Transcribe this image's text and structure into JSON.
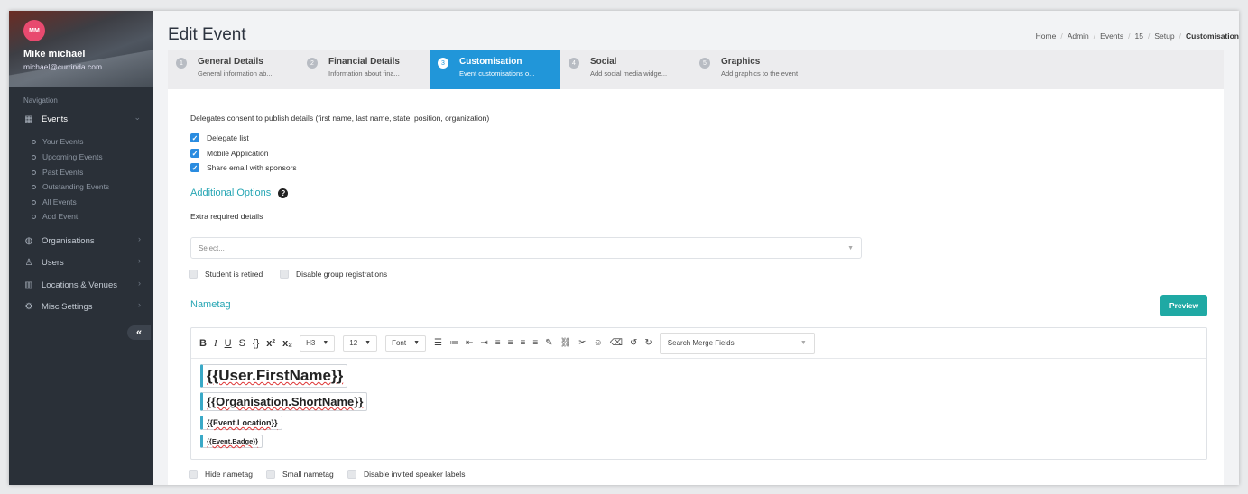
{
  "sidebar": {
    "avatar_initials": "MM",
    "user_name": "Mike michael",
    "user_email": "michael@currinda.com",
    "nav_heading": "Navigation",
    "items": [
      {
        "label": "Events",
        "icon": "calendar-icon"
      },
      {
        "label": "Organisations",
        "icon": "globe-icon"
      },
      {
        "label": "Users",
        "icon": "user-icon"
      },
      {
        "label": "Locations & Venues",
        "icon": "map-icon"
      },
      {
        "label": "Misc Settings",
        "icon": "gear-icon"
      }
    ],
    "sub_items": [
      "Your Events",
      "Upcoming Events",
      "Past Events",
      "Outstanding Events",
      "All Events",
      "Add Event"
    ],
    "collapse_label": "«"
  },
  "page": {
    "title": "Edit Event",
    "breadcrumb": [
      "Home",
      "Admin",
      "Events",
      "15",
      "Setup",
      "Customisation"
    ]
  },
  "steps": [
    {
      "num": "1",
      "title": "General Details",
      "desc": "General information ab..."
    },
    {
      "num": "2",
      "title": "Financial Details",
      "desc": "Information about fina..."
    },
    {
      "num": "3",
      "title": "Customisation",
      "desc": "Event customisations o..."
    },
    {
      "num": "4",
      "title": "Social",
      "desc": "Add social media widge..."
    },
    {
      "num": "5",
      "title": "Graphics",
      "desc": "Add graphics to the event"
    }
  ],
  "form": {
    "consent_text": "Delegates consent to publish details (first name, last name, state, position, organization)",
    "consent_checks": [
      "Delegate list",
      "Mobile Application",
      "Share email with sponsors"
    ],
    "additional_title": "Additional Options",
    "extra_label": "Extra required details",
    "select_placeholder": "Select...",
    "options_checks": [
      "Student is retired",
      "Disable group registrations"
    ],
    "nametag_title": "Nametag",
    "preview_label": "Preview",
    "bottom_checks": [
      "Hide nametag",
      "Small nametag",
      "Disable invited speaker labels"
    ]
  },
  "editor": {
    "heading_value": "H3",
    "size_value": "12",
    "font_value": "Font",
    "merge_placeholder": "Search Merge Fields",
    "tags": [
      "{{User.FirstName}}",
      "{{Organisation.ShortName}}",
      "{{Event.Location}}",
      "{{Event.Badge}}"
    ]
  }
}
